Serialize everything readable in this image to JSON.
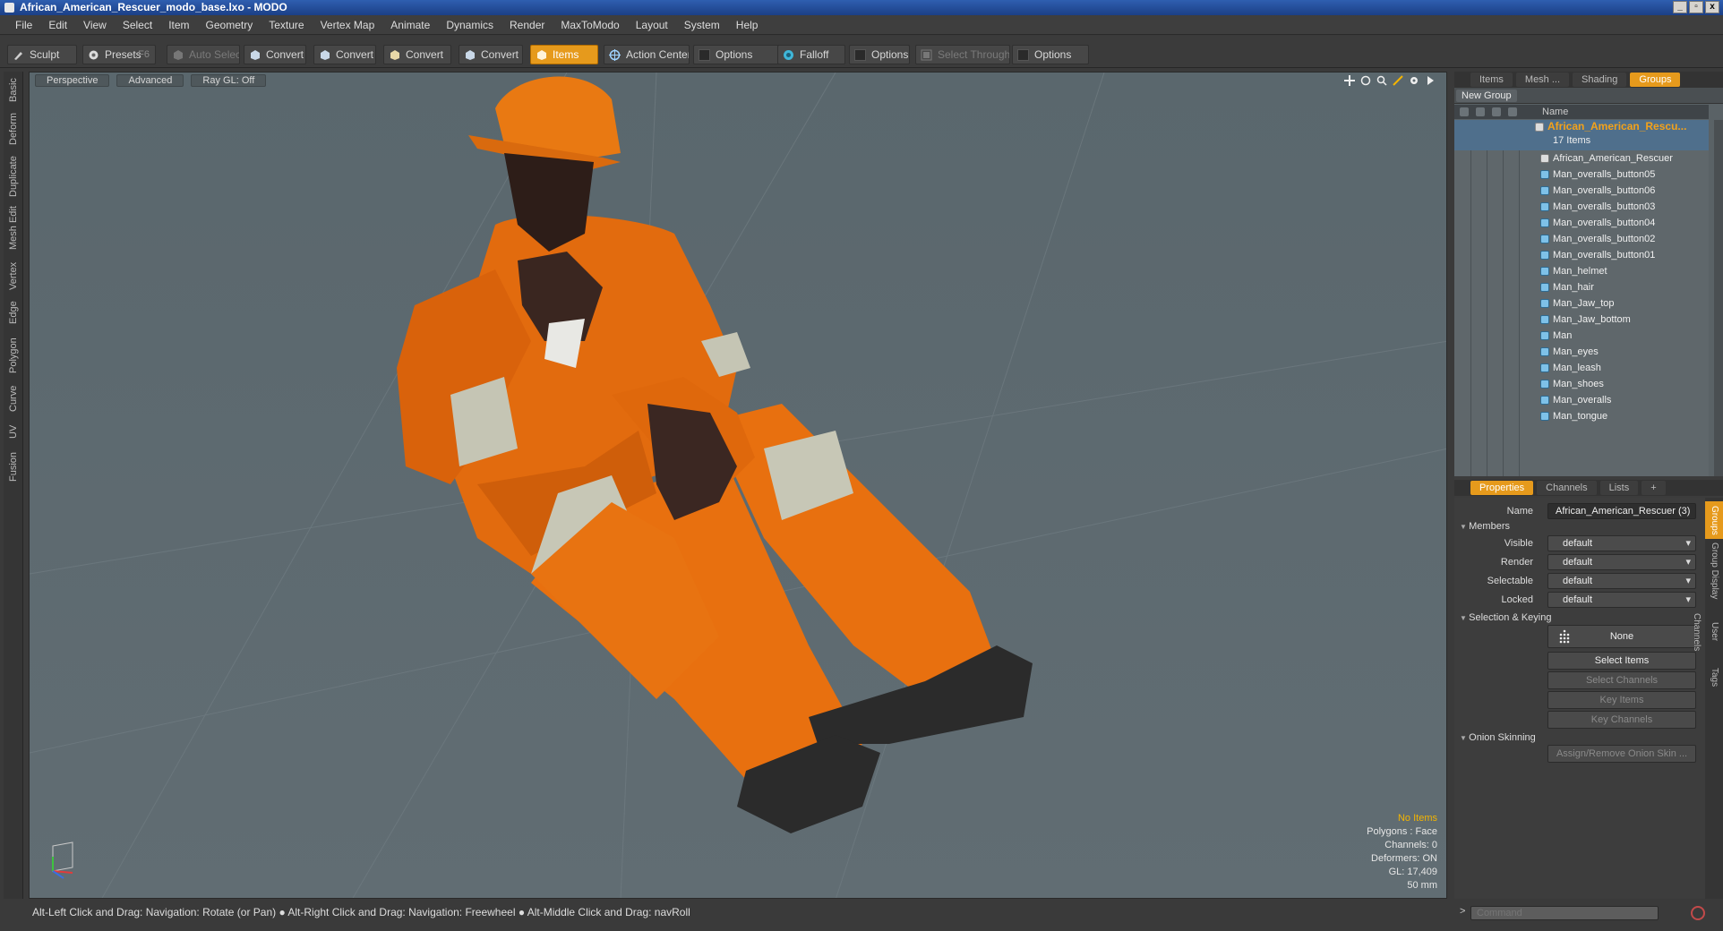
{
  "window": {
    "title": "African_American_Rescuer_modo_base.lxo - MODO",
    "buttons": [
      "_",
      "▫",
      "x"
    ]
  },
  "menu": [
    "File",
    "Edit",
    "View",
    "Select",
    "Item",
    "Geometry",
    "Texture",
    "Vertex Map",
    "Animate",
    "Dynamics",
    "Render",
    "MaxToModo",
    "Layout",
    "System",
    "Help"
  ],
  "toolbar": {
    "sculpt": "Sculpt",
    "presets": "Presets",
    "presets_key": "F6",
    "auto_select": "Auto Select",
    "convert1": "Convert",
    "convert2": "Convert",
    "convert3": "Convert",
    "convert4": "Convert",
    "items": "Items",
    "action_center": "Action Center",
    "options1": "Options",
    "falloff": "Falloff",
    "options2": "Options",
    "select_through": "Select Through",
    "options3": "Options"
  },
  "left_tabs": [
    "Basic",
    "Deform",
    "Duplicate",
    "Mesh Edit",
    "Vertex",
    "Edge",
    "Polygon",
    "Curve",
    "UV",
    "Fusion"
  ],
  "viewport": {
    "view": "Perspective",
    "shading": "Advanced",
    "raygl": "Ray GL: Off",
    "hud": {
      "items": "No Items",
      "polygons": "Polygons : Face",
      "channels": "Channels: 0",
      "deformers": "Deformers: ON",
      "gl": "GL: 17,409",
      "lens": "50 mm"
    }
  },
  "status": "Alt-Left Click and Drag: Navigation: Rotate (or Pan) ● Alt-Right Click and Drag: Navigation: Freewheel ● Alt-Middle Click and Drag: navRoll",
  "panel_tabs": [
    "Items",
    "Mesh ...",
    "Shading",
    "Groups"
  ],
  "groups": {
    "new_group": "New Group",
    "col_name": "Name",
    "group_name": "African_American_Rescu...",
    "group_count": "17 Items",
    "items": [
      "African_American_Rescuer",
      "Man_overalls_button05",
      "Man_overalls_button06",
      "Man_overalls_button03",
      "Man_overalls_button04",
      "Man_overalls_button02",
      "Man_overalls_button01",
      "Man_helmet",
      "Man_hair",
      "Man_Jaw_top",
      "Man_Jaw_bottom",
      "Man",
      "Man_eyes",
      "Man_leash",
      "Man_shoes",
      "Man_overalls",
      "Man_tongue"
    ]
  },
  "props_tabs": [
    "Properties",
    "Channels",
    "Lists",
    "+"
  ],
  "props": {
    "name_label": "Name",
    "name_value": "African_American_Rescuer (3)",
    "members": "Members",
    "visible_label": "Visible",
    "visible_value": "default",
    "render_label": "Render",
    "render_value": "default",
    "selectable_label": "Selectable",
    "selectable_value": "default",
    "locked_label": "Locked",
    "locked_value": "default",
    "sel_keying": "Selection & Keying",
    "none": "None",
    "select_items": "Select Items",
    "select_channels": "Select Channels",
    "key_items": "Key Items",
    "key_channels": "Key Channels",
    "onion": "Onion Skinning",
    "assign_onion": "Assign/Remove Onion Skin ..."
  },
  "side_tabs": [
    "Groups",
    "Group Display",
    "User Channels",
    "Tags"
  ],
  "command": {
    "prompt": ">",
    "placeholder": "Command"
  },
  "colors": {
    "accent": "#e69a1c",
    "group_text": "#f3a21a",
    "hud_highlight": "#f4b400",
    "viewport_bg": "#5d6a70"
  }
}
